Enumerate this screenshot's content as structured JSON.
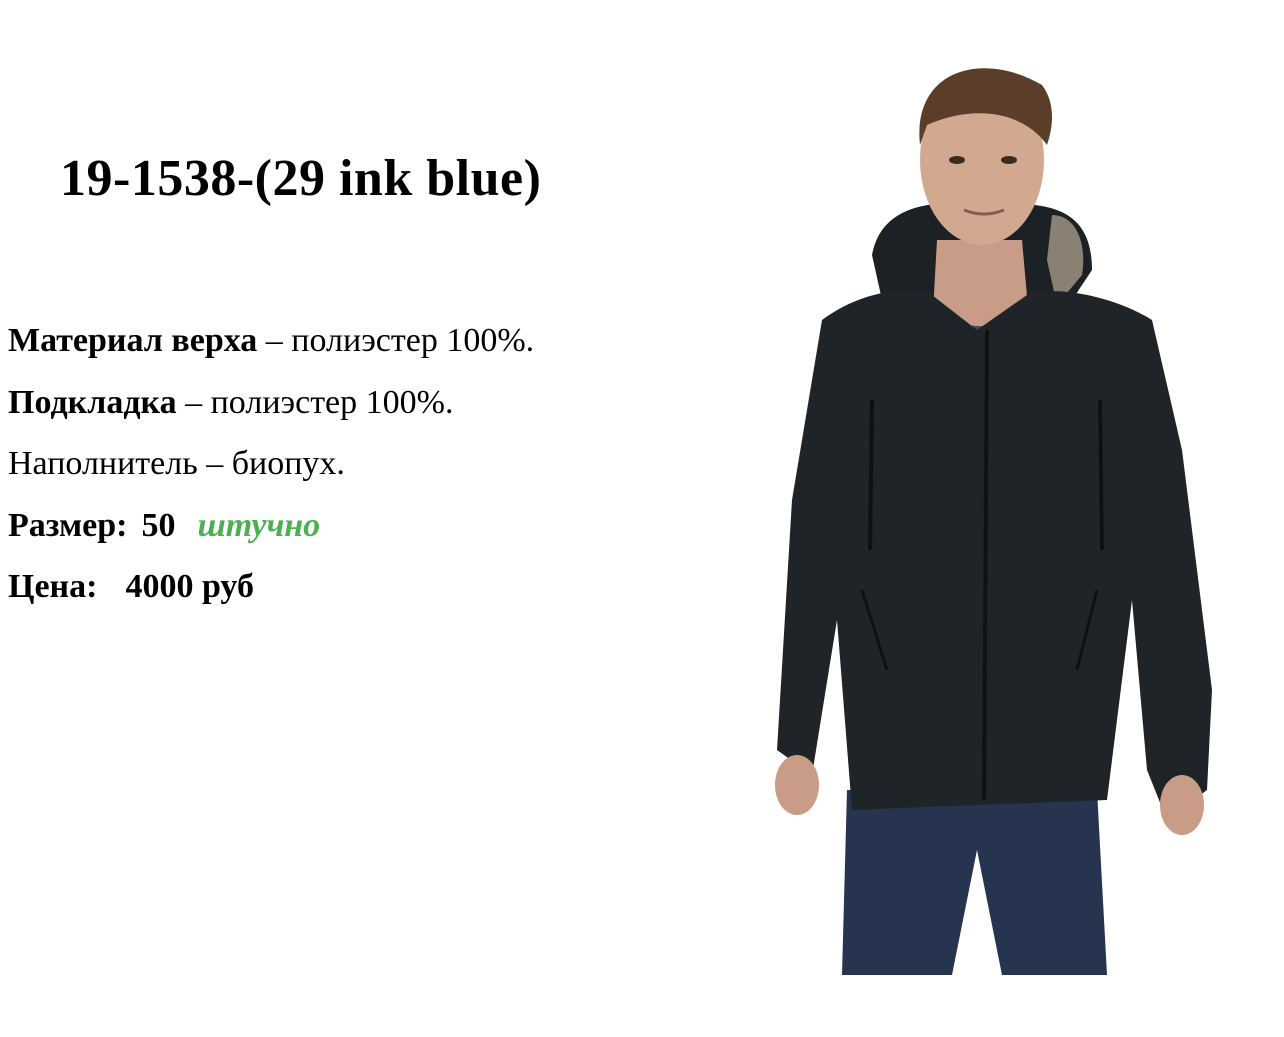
{
  "product": {
    "title": "19-1538-(29 ink blue)",
    "material": {
      "label": "Материал верха",
      "value": "– полиэстер 100%."
    },
    "lining": {
      "label": "Подкладка",
      "value": "– полиэстер 100%."
    },
    "filler": {
      "text": "Наполнитель – биопух."
    },
    "size": {
      "label": "Размер:",
      "value": "50",
      "note": "штучно",
      "note_color": "#4caf50"
    },
    "price": {
      "label": "Цена:",
      "value": "4000 руб"
    }
  },
  "image": {
    "subject": "model-wearing-dark-hooded-winter-jacket",
    "jacket_color": "#1f2429",
    "jeans_color": "#26344f"
  }
}
